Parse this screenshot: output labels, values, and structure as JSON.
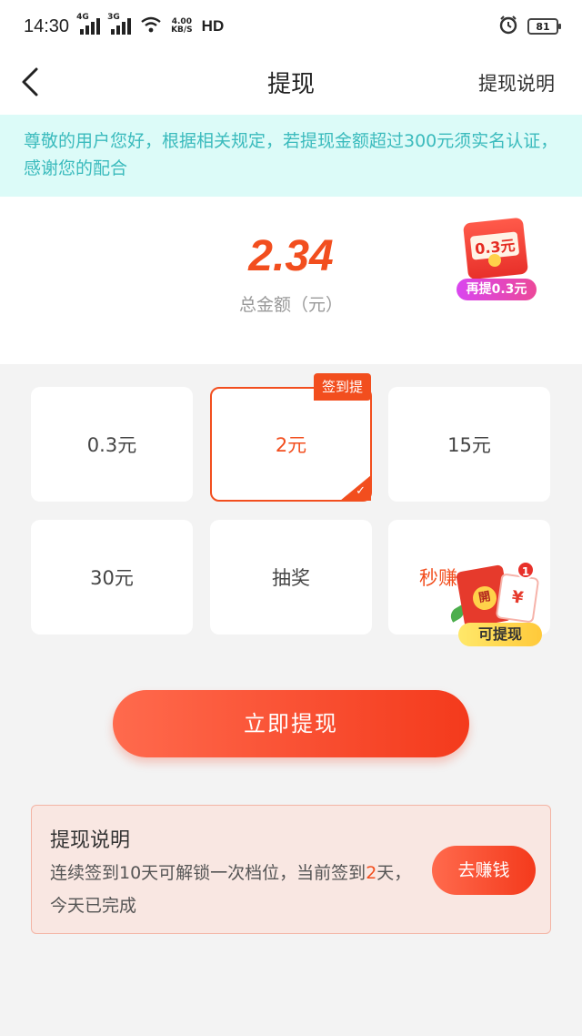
{
  "status": {
    "time": "14:30",
    "sim1": "4G",
    "sim2": "3G",
    "speed_value": "4.00",
    "speed_unit": "KB/S",
    "hd": "HD",
    "battery": "81"
  },
  "nav": {
    "title": "提现",
    "help_link": "提现说明"
  },
  "notice": {
    "text": "尊敬的用户您好，根据相关规定，若提现金额超过300元须实名认证，感谢您的配合"
  },
  "balance": {
    "amount": "2.34",
    "label": "总金额（元）",
    "promo_envelope": "0.3元",
    "promo_tag": "再提0.3元"
  },
  "options": [
    {
      "label": "0.3元",
      "selected": false
    },
    {
      "label": "2元",
      "selected": true,
      "ribbon": "签到提"
    },
    {
      "label": "15元",
      "selected": false
    },
    {
      "label": "30元",
      "selected": false
    },
    {
      "label": "抽奖",
      "selected": false
    },
    {
      "label": "秒赚",
      "selected": false
    }
  ],
  "float_ad": {
    "badge": "1",
    "envelope_char": "開",
    "coupon_char": "¥",
    "label": "可提现"
  },
  "withdraw_button": "立即提现",
  "info": {
    "title": "提现说明",
    "text_before": "连续签到10天可解锁一次档位，当前签到",
    "days": "2",
    "text_after": "天，今天已完成",
    "earn_button": "去赚钱"
  },
  "colors": {
    "accent": "#f24e1e",
    "notice_bg": "#dcfbf8",
    "notice_text": "#3bbbbd",
    "info_bg": "#f9e7e2"
  }
}
